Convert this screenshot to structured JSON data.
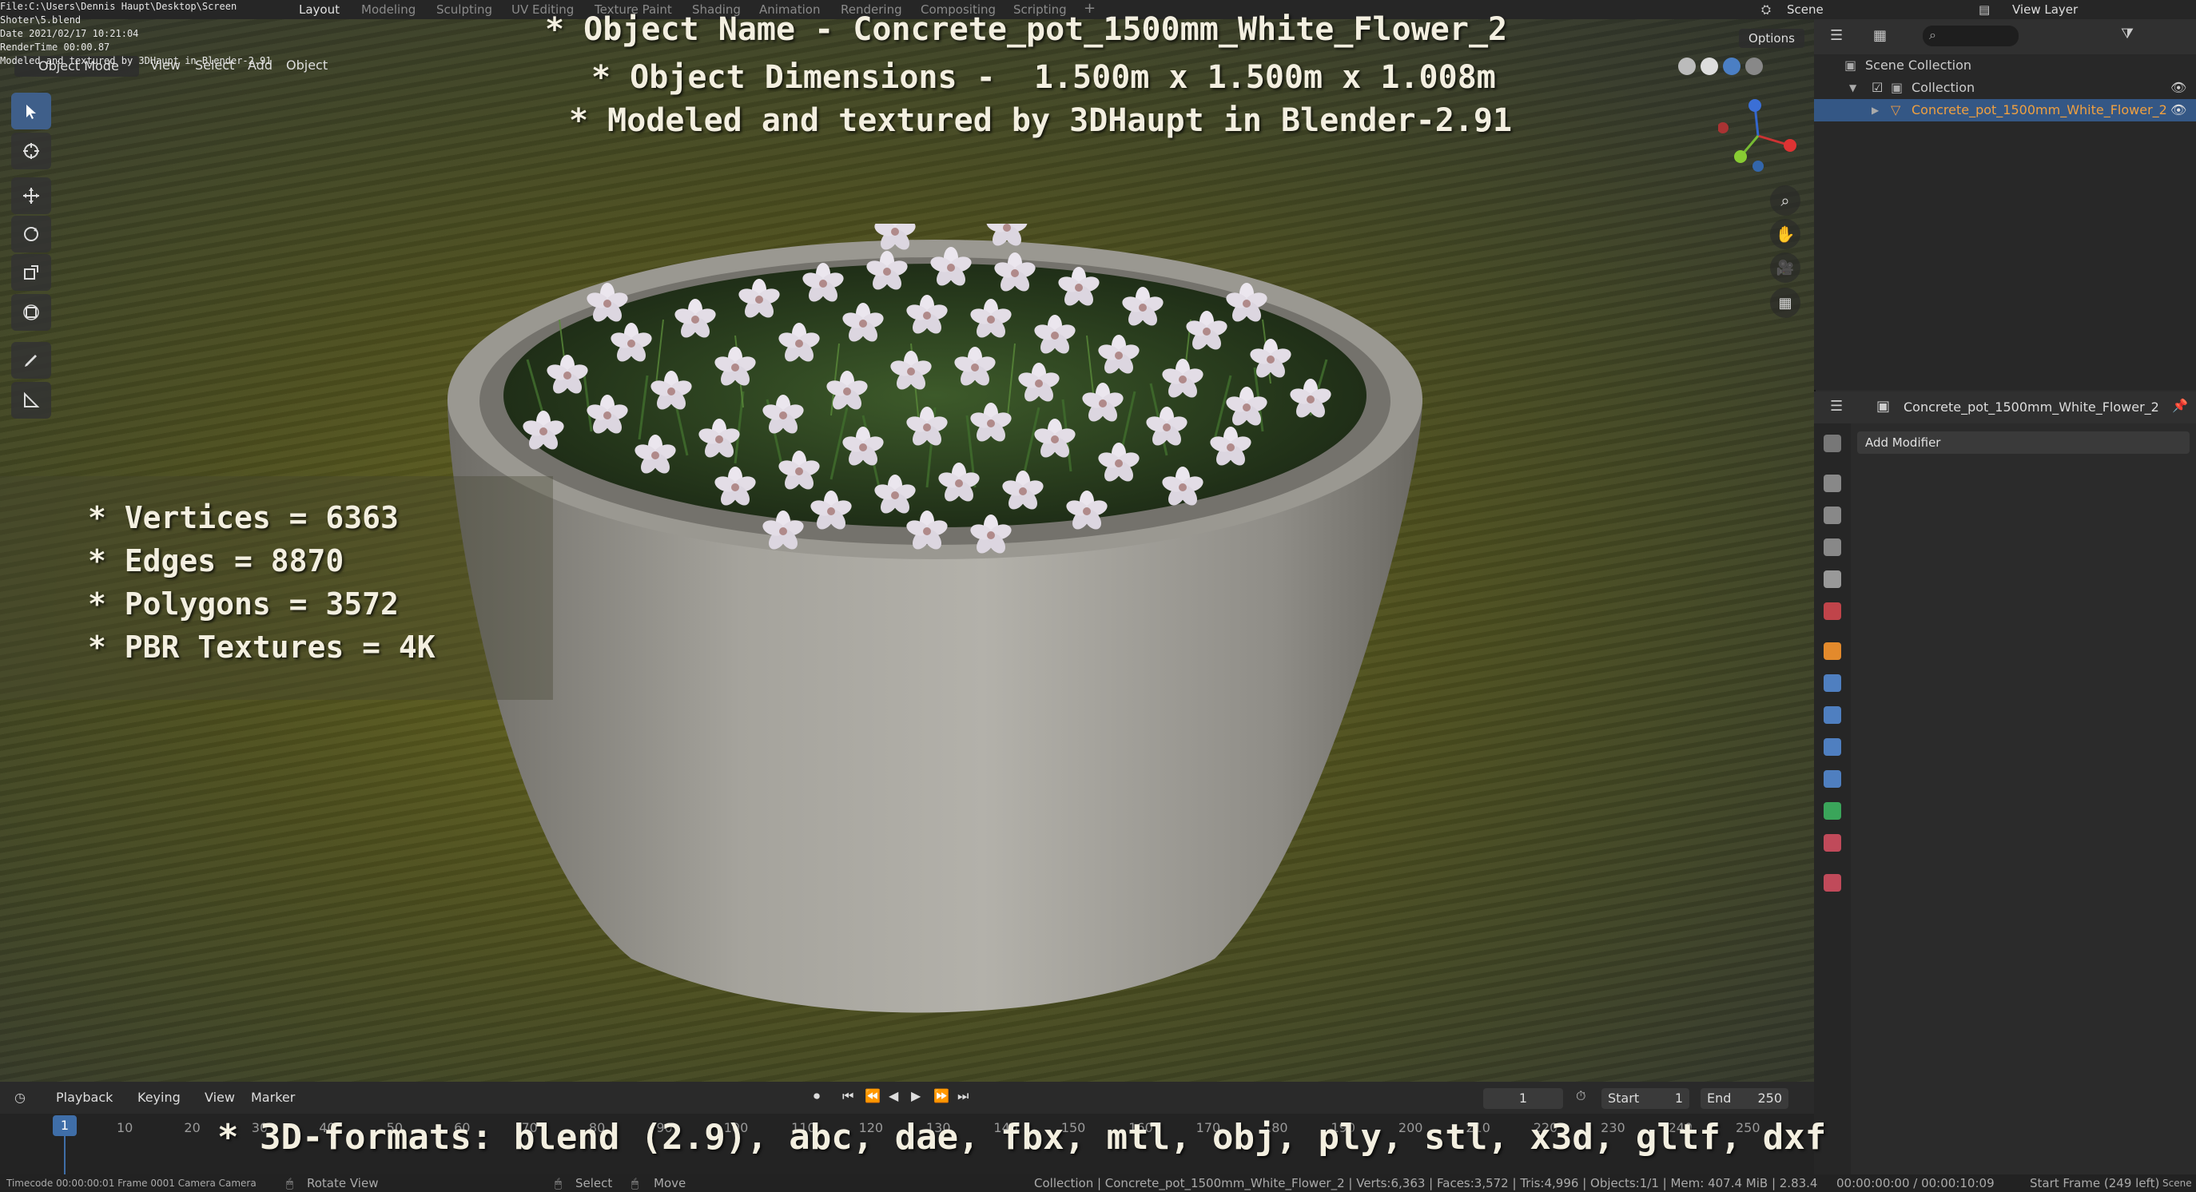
{
  "topbar": {
    "workspaces": [
      "Layout",
      "Modeling",
      "Sculpting",
      "UV Editing",
      "Texture Paint",
      "Shading",
      "Animation",
      "Rendering",
      "Compositing",
      "Scripting"
    ],
    "add_label": "+",
    "scene_label": "Scene",
    "view_layer_label": "View Layer"
  },
  "meta": {
    "file": "File:C:\\Users\\Dennis Haupt\\Desktop\\Screen Shoter\\5.blend",
    "date": "Date 2021/02/17 10:21:04",
    "render_time": "RenderTime 00:00.87",
    "credit": "Modeled and textured by 3DHaupt in Blender-2.91"
  },
  "viewport_header": {
    "mode": "Object Mode",
    "menus": [
      "View",
      "Select",
      "Add",
      "Object"
    ],
    "options_label": "Options"
  },
  "overlay": {
    "title_name": "* Object Name - Concrete_pot_1500mm_White_Flower_2",
    "title_dims": "* Object Dimensions -  1.500m x 1.500m x 1.008m",
    "title_model": "* Modeled and textured by 3DHaupt in Blender-2.91",
    "stats": [
      "* Vertices = 6363",
      "* Edges = 8870",
      "* Polygons = 3572",
      "* PBR Textures = 4K"
    ],
    "formats": "* 3D-formats: blend (2.9), abc, dae, fbx, mtl, obj, ply, stl, x3d, gltf, dxf"
  },
  "outliner": {
    "scene_collection": "Scene Collection",
    "collection": "Collection",
    "object": "Concrete_pot_1500mm_White_Flower_2"
  },
  "properties": {
    "object_name": "Concrete_pot_1500mm_White_Flower_2",
    "add_modifier": "Add Modifier"
  },
  "timeline": {
    "menus": [
      "Playback",
      "Keying",
      "View",
      "Marker"
    ],
    "current_frame": "1",
    "start_label": "Start",
    "start_value": "1",
    "end_label": "End",
    "end_value": "250",
    "ticks": [
      "1",
      "10",
      "20",
      "30",
      "40",
      "50",
      "60",
      "70",
      "80",
      "90",
      "100",
      "110",
      "120",
      "130",
      "140",
      "150",
      "160",
      "170",
      "180",
      "190",
      "200",
      "210",
      "220",
      "230",
      "240",
      "250"
    ]
  },
  "status": {
    "left": "Timecode 00:00:00:01   Frame 0001   Camera Camera",
    "rotate": "Rotate View",
    "select": "Select",
    "move": "Move",
    "info": "Collection | Concrete_pot_1500mm_White_Flower_2 | Verts:6,363 | Faces:3,572 | Tris:4,996 | Objects:1/1 | Mem: 407.4 MiB | 2.83.4",
    "time": "00:00:00:00 / 00:00:10:09",
    "start_frame": "Start Frame (249 left)",
    "scene": "Scene"
  },
  "colors": {
    "accent": "#3f6ea8",
    "selection": "#345785",
    "overlay_text": "#f3efe0"
  }
}
